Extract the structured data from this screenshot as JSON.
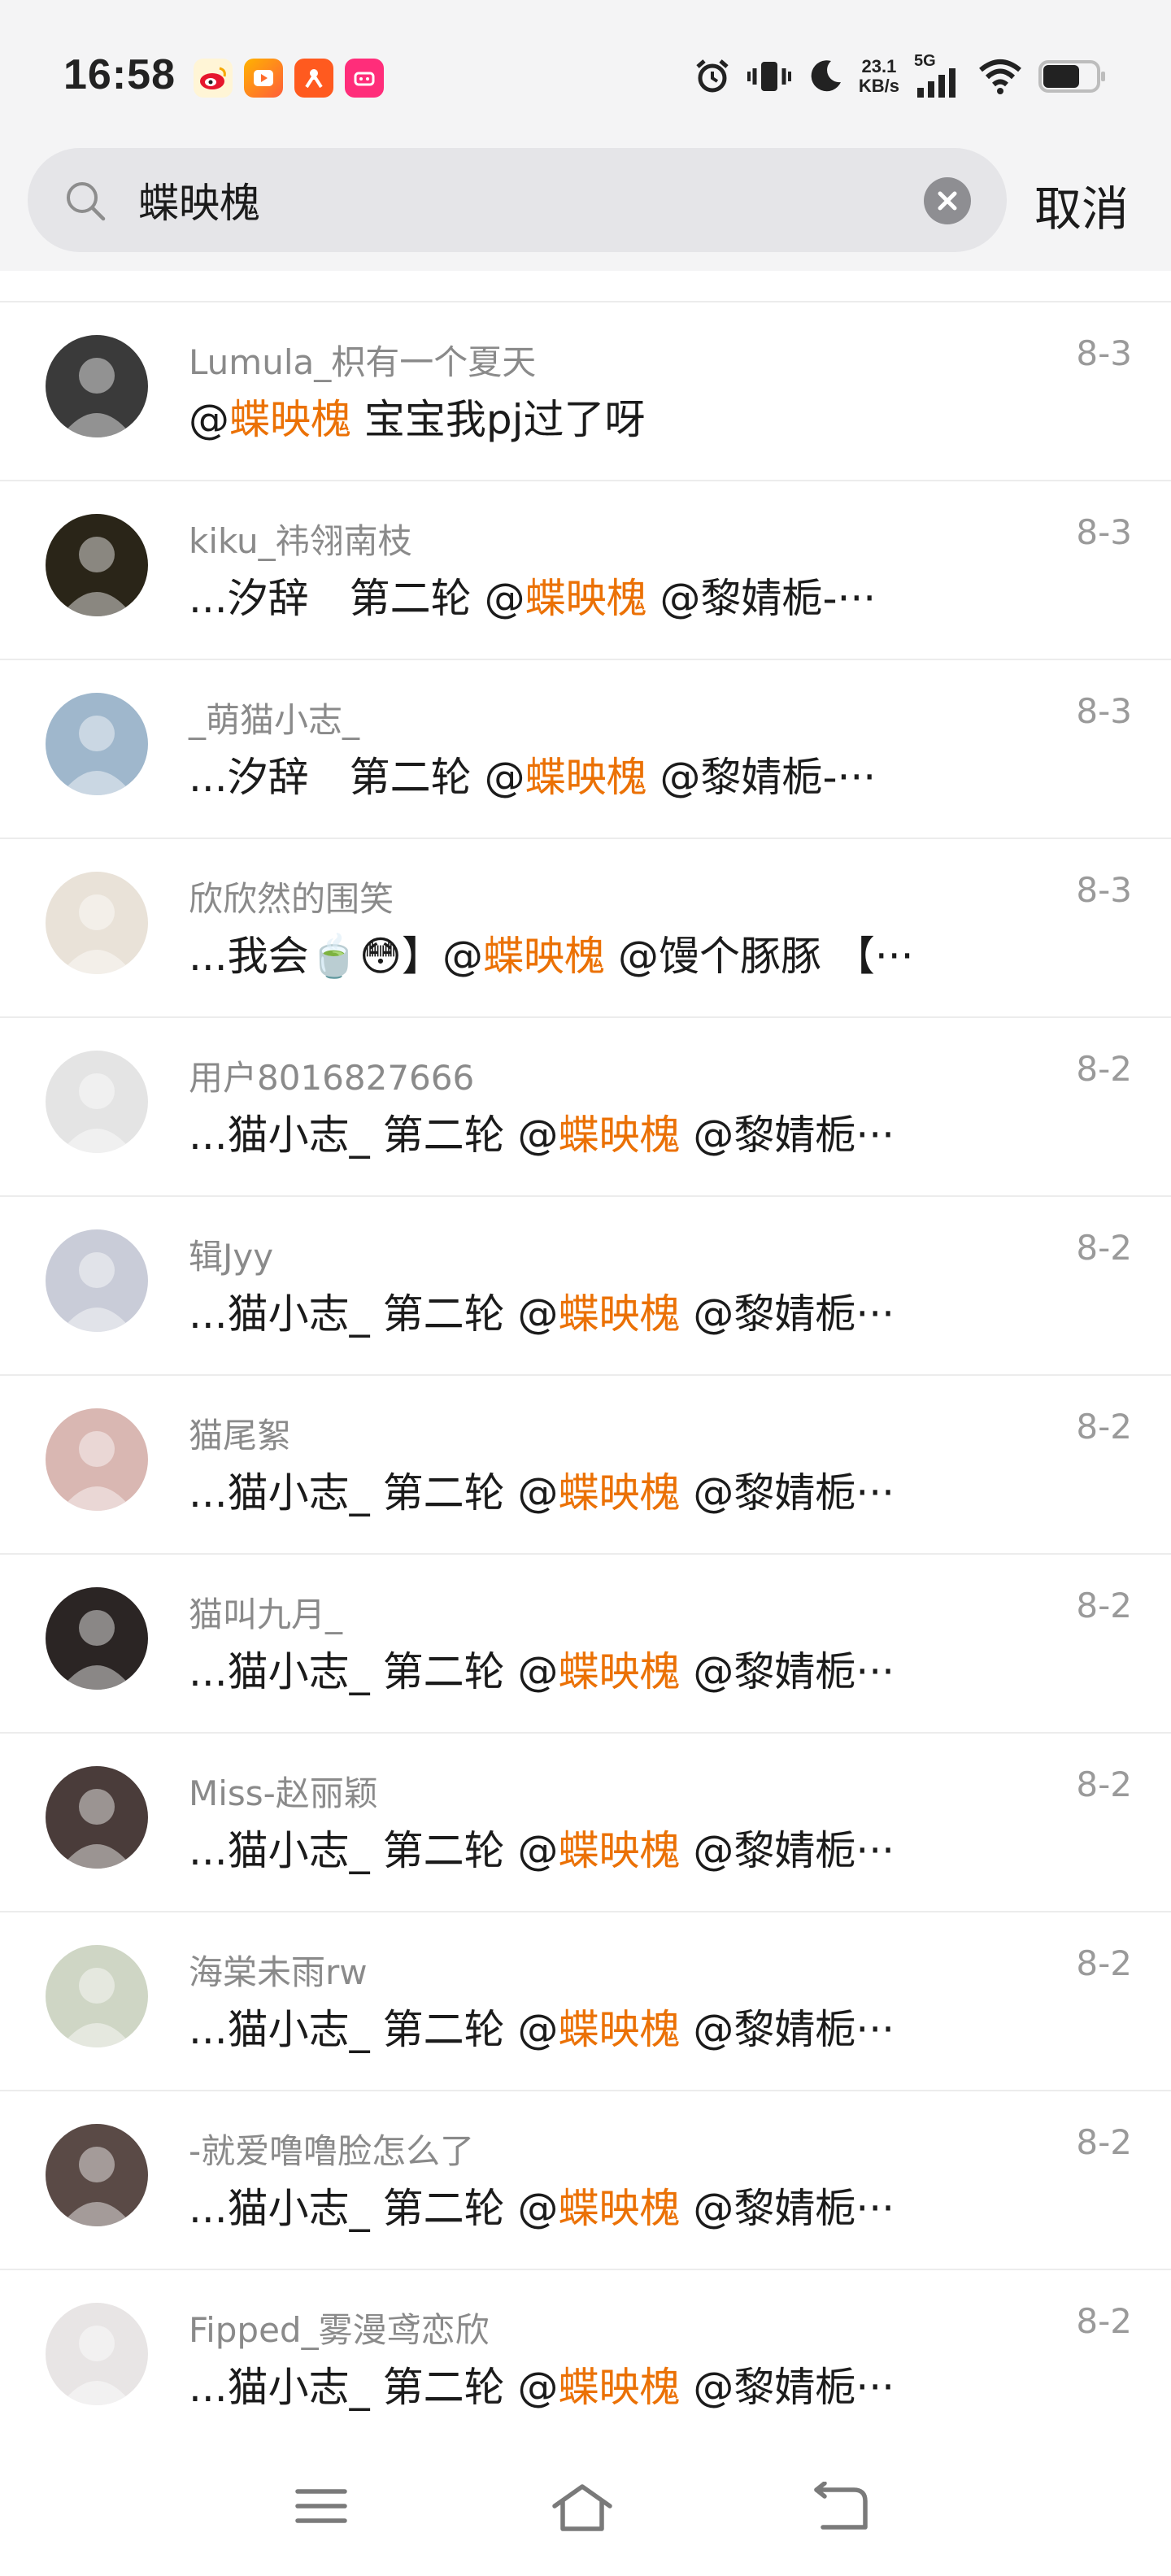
{
  "status_bar": {
    "time": "16:58",
    "net_speed_value": "23.1",
    "net_speed_unit": "KB/s",
    "network_type": "5G",
    "app_icons": [
      "weibo-icon",
      "video-icon",
      "xiaohongshu-icon",
      "pink-app-icon"
    ]
  },
  "search": {
    "query": "蝶映槐",
    "cancel_label": "取消"
  },
  "results": [
    {
      "name": "Lumula_枳有一个夏天",
      "date": "8-3",
      "pre": "@",
      "hl": "蝶映槐",
      "post": " 宝宝我pj过了呀",
      "avatar_color": "#3a3a3a"
    },
    {
      "name": "kiku_祎翎南枝",
      "date": "8-3",
      "pre": "...汐辞　第二轮 @",
      "hl": "蝶映槐",
      "post": " @黎婧栀-···",
      "avatar_color": "#2a2518"
    },
    {
      "name": "_萌猫小志_",
      "date": "8-3",
      "pre": "...汐辞　第二轮 @",
      "hl": "蝶映槐",
      "post": " @黎婧栀-···",
      "avatar_color": "#9fb7cc"
    },
    {
      "name": "欣欣然的围笑",
      "date": "8-3",
      "pre": "...我会🍵😳】@",
      "hl": "蝶映槐",
      "post": " @馒个豚豚 【···",
      "avatar_color": "#e9e2d8"
    },
    {
      "name": "用户8016827666",
      "date": "8-2",
      "pre": "...猫小志_ 第二轮 @",
      "hl": "蝶映槐",
      "post": " @黎婧栀···",
      "avatar_color": "#e4e4e4"
    },
    {
      "name": "辑Jyy",
      "date": "8-2",
      "pre": "...猫小志_ 第二轮 @",
      "hl": "蝶映槐",
      "post": " @黎婧栀···",
      "avatar_color": "#c9ccd8"
    },
    {
      "name": "猫尾絮",
      "date": "8-2",
      "pre": "...猫小志_ 第二轮 @",
      "hl": "蝶映槐",
      "post": " @黎婧栀···",
      "avatar_color": "#d9b7b2"
    },
    {
      "name": "猫叫九月_",
      "date": "8-2",
      "pre": "...猫小志_ 第二轮 @",
      "hl": "蝶映槐",
      "post": " @黎婧栀···",
      "avatar_color": "#2b2524"
    },
    {
      "name": "Miss-赵丽颖",
      "date": "8-2",
      "pre": "...猫小志_ 第二轮 @",
      "hl": "蝶映槐",
      "post": " @黎婧栀···",
      "avatar_color": "#4a3c3a"
    },
    {
      "name": "海棠未雨rw",
      "date": "8-2",
      "pre": "...猫小志_ 第二轮 @",
      "hl": "蝶映槐",
      "post": " @黎婧栀···",
      "avatar_color": "#cfd6c5"
    },
    {
      "name": "-就爱噜噜脸怎么了",
      "date": "8-2",
      "pre": "...猫小志_ 第二轮 @",
      "hl": "蝶映槐",
      "post": " @黎婧栀···",
      "avatar_color": "#5a4a46"
    },
    {
      "name": "Fipped_雾漫鸢恋欣",
      "date": "8-2",
      "pre": "...猫小志_ 第二轮 @",
      "hl": "蝶映槐",
      "post": " @黎婧栀···",
      "avatar_color": "#e8e5e5"
    }
  ]
}
